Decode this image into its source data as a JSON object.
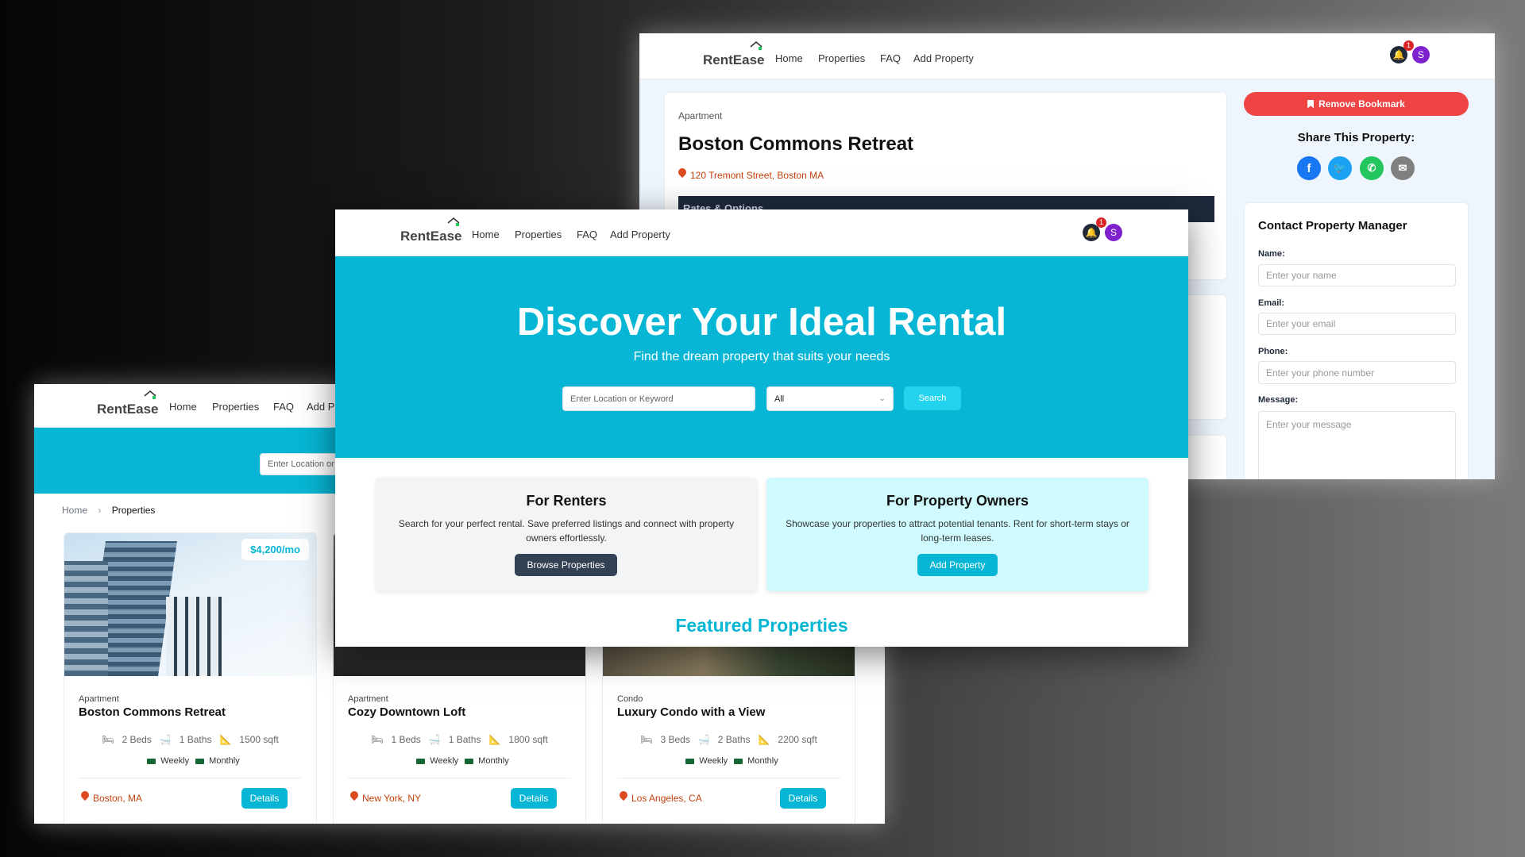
{
  "nav": {
    "brand": "RentEase",
    "links": [
      "Home",
      "Properties",
      "FAQ",
      "Add Property"
    ],
    "notification_count": "1",
    "avatar_initial": "S"
  },
  "colors": {
    "primary": "#06b6d4",
    "danger": "#ef4444",
    "dark": "#1f2937",
    "avatar": "#7e22ce",
    "location": "#c2410c"
  },
  "detail_window": {
    "property": {
      "type": "Apartment",
      "title": "Boston Commons Retreat",
      "address": "120 Tremont Street, Boston MA",
      "rates_heading": "Rates & Options"
    },
    "remove_bookmark": "Remove Bookmark",
    "share_heading": "Share This Property:",
    "share_icons": [
      "facebook-icon",
      "twitter-icon",
      "whatsapp-icon",
      "email-icon"
    ],
    "contact": {
      "title": "Contact Property Manager",
      "fields": [
        {
          "label": "Name:",
          "placeholder": "Enter your name"
        },
        {
          "label": "Email:",
          "placeholder": "Enter your email"
        },
        {
          "label": "Phone:",
          "placeholder": "Enter your phone number"
        },
        {
          "label": "Message:",
          "placeholder": "Enter your message"
        }
      ]
    }
  },
  "home_window": {
    "hero": {
      "title": "Discover Your Ideal Rental",
      "subtitle": "Find the dream property that suits your needs",
      "search_placeholder": "Enter Location or Keyword",
      "select_value": "All",
      "search_button": "Search"
    },
    "renters": {
      "title": "For Renters",
      "text": "Search for your perfect rental. Save preferred listings and connect with property owners effortlessly.",
      "button": "Browse Properties"
    },
    "owners": {
      "title": "For Property Owners",
      "text": "Showcase your properties to attract potential tenants. Rent for short-term stays or long-term leases.",
      "button": "Add Property"
    },
    "featured_heading": "Featured Properties"
  },
  "listing_window": {
    "search_placeholder": "Enter Location or Keyword",
    "breadcrumb": [
      "Home",
      "Properties"
    ],
    "cards": [
      {
        "price": "$4,200/mo",
        "type": "Apartment",
        "title": "Boston Commons Retreat",
        "beds": "2 Beds",
        "baths": "1 Baths",
        "area": "1500 sqft",
        "tags": [
          "Weekly",
          "Monthly"
        ],
        "location": "Boston, MA",
        "button": "Details"
      },
      {
        "type": "Apartment",
        "title": "Cozy Downtown Loft",
        "beds": "1 Beds",
        "baths": "1 Baths",
        "area": "1800 sqft",
        "tags": [
          "Weekly",
          "Monthly"
        ],
        "location": "New York, NY",
        "button": "Details"
      },
      {
        "type": "Condo",
        "title": "Luxury Condo with a View",
        "beds": "3 Beds",
        "baths": "2 Baths",
        "area": "2200 sqft",
        "tags": [
          "Weekly",
          "Monthly"
        ],
        "location": "Los Angeles, CA",
        "button": "Details"
      }
    ]
  }
}
